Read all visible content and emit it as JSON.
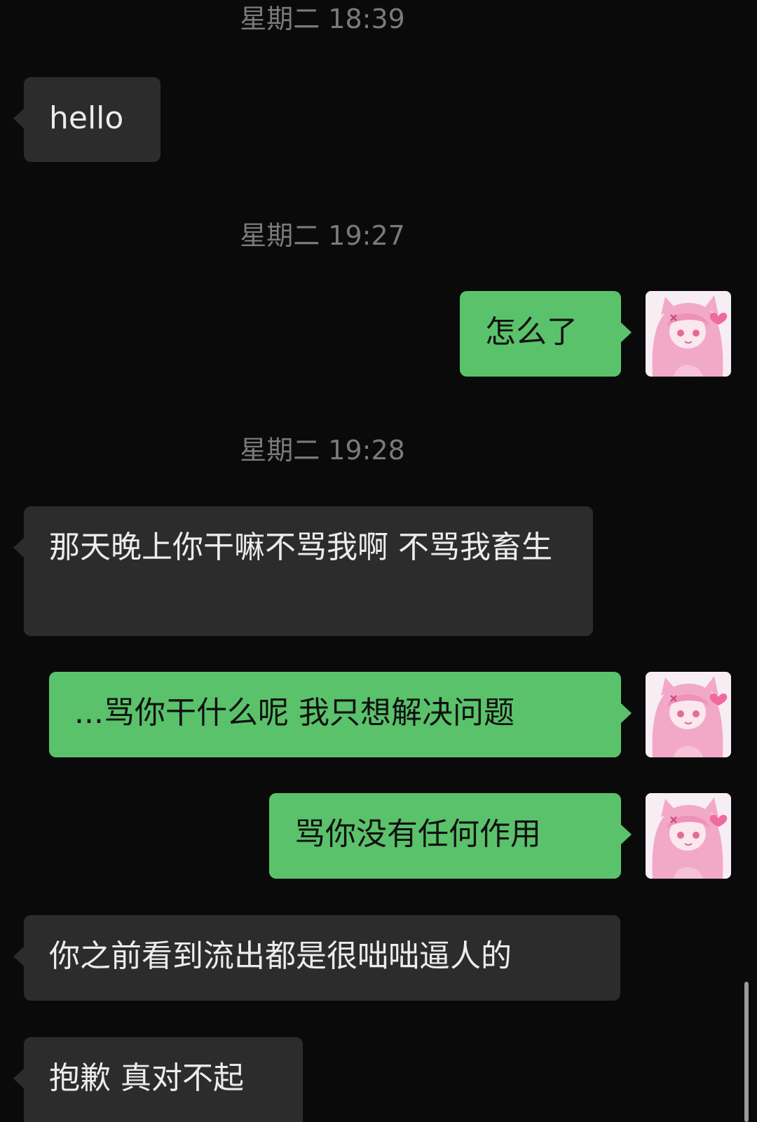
{
  "timestamps": {
    "t1": "星期二 18:39",
    "t2": "星期二 19:27",
    "t3": "星期二 19:28"
  },
  "messages": [
    {
      "side": "received",
      "text": "hello"
    },
    {
      "side": "sent",
      "text": "怎么了"
    },
    {
      "side": "received",
      "text": "那天晚上你干嘛不骂我啊 不骂我畜生"
    },
    {
      "side": "sent",
      "text": "...骂你干什么呢 我只想解决问题"
    },
    {
      "side": "sent",
      "text": "骂你没有任何作用"
    },
    {
      "side": "received",
      "text": "你之前看到流出都是很咄咄逼人的"
    },
    {
      "side": "received",
      "text": "抱歉 真对不起"
    }
  ],
  "avatar_icon": "anime-girl-pink-avatar",
  "colors": {
    "background": "#0a0a0a",
    "sent_bubble": "#5ac26b",
    "received_bubble": "#2c2c2c",
    "timestamp": "#7a7a7a"
  }
}
